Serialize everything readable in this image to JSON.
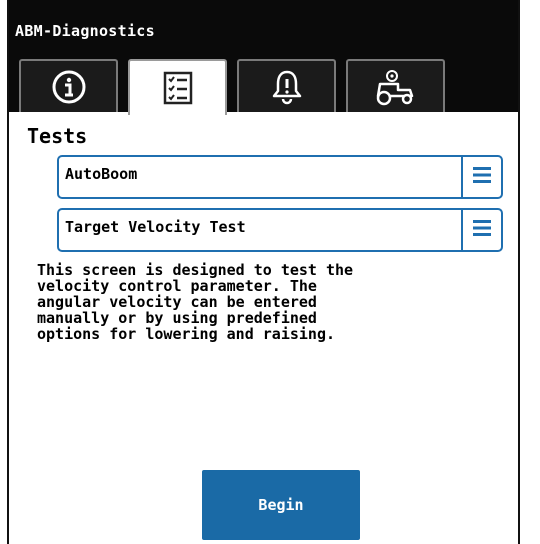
{
  "app": {
    "title": "ABM-Diagnostics"
  },
  "tabs": [
    {
      "icon": "info-icon",
      "active": false
    },
    {
      "icon": "checklist-icon",
      "active": true
    },
    {
      "icon": "alarm-bell-icon",
      "active": false
    },
    {
      "icon": "tractor-settings-icon",
      "active": false
    }
  ],
  "main": {
    "section_title": "Tests",
    "system_select": {
      "value": "AutoBoom",
      "menu_icon": "hamburger-menu-icon"
    },
    "test_select": {
      "value": "Target Velocity Test",
      "menu_icon": "hamburger-menu-icon"
    },
    "description": "This screen is designed to test the\nvelocity control parameter. The\nangular velocity can be entered\nmanually or by using predefined\noptions for lowering and raising.",
    "begin_label": "Begin"
  },
  "colors": {
    "accent": "#1f6fb0",
    "button": "#1a6aa6",
    "titlebar": "#0a0a0a"
  }
}
